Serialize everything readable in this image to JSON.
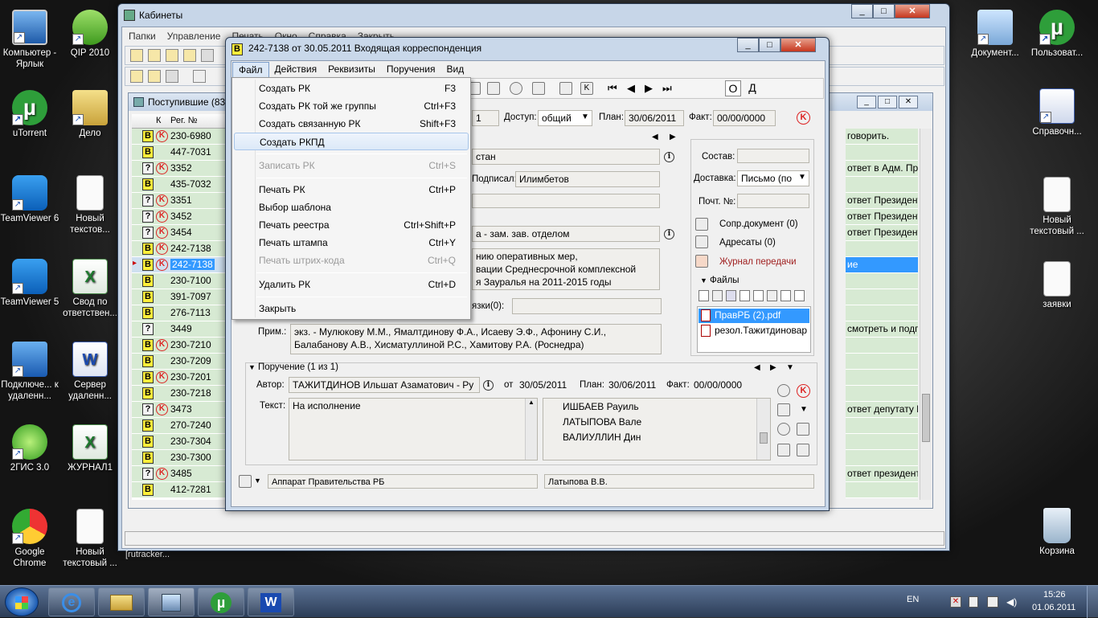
{
  "desktop": {
    "left_icons": [
      "Компьютер - Ярлык",
      "QIP 2010",
      "uTorrent",
      "Дело",
      "TeamViewer 6",
      "Новый текстов...",
      "TeamViewer 5",
      "Свод по ответствен...",
      "Подключе... к удаленн...",
      "Сервер удаленн...",
      "2ГИС 3.0",
      "ЖУРНАЛ1",
      "Google Chrome",
      "Новый текстовый ..."
    ],
    "right_icons": [
      "Документ...",
      "Пользоват...",
      "Справочн...",
      "Новый текстовый ...",
      "заявки",
      "Корзина"
    ],
    "bg_label": "[rutracker..."
  },
  "main_window": {
    "title": "Кабинеты",
    "menu": [
      "Папки",
      "Управление",
      "Печать",
      "Окно",
      "Справка",
      "Закрыть"
    ],
    "inner_title": "Поступившие (83",
    "grid_headers": [
      "К",
      "Рег. №"
    ],
    "rows": [
      {
        "b": "B",
        "k": true,
        "num": "230-6980"
      },
      {
        "b": "B",
        "k": false,
        "num": "447-7031"
      },
      {
        "b": "?",
        "k": true,
        "num": "3352"
      },
      {
        "b": "B",
        "k": false,
        "num": "435-7032"
      },
      {
        "b": "?",
        "k": true,
        "num": "3351"
      },
      {
        "b": "?",
        "k": true,
        "num": "3452"
      },
      {
        "b": "?",
        "k": true,
        "num": "3454"
      },
      {
        "b": "B",
        "k": true,
        "num": "242-7138"
      },
      {
        "b": "B",
        "k": true,
        "num": "242-7138"
      },
      {
        "b": "B",
        "k": false,
        "num": "230-7100"
      },
      {
        "b": "B",
        "k": false,
        "num": "391-7097"
      },
      {
        "b": "B",
        "k": false,
        "num": "276-7113"
      },
      {
        "b": "?",
        "k": false,
        "num": "3449"
      },
      {
        "b": "B",
        "k": true,
        "num": "230-7210"
      },
      {
        "b": "B",
        "k": false,
        "num": "230-7209"
      },
      {
        "b": "B",
        "k": true,
        "num": "230-7201"
      },
      {
        "b": "B",
        "k": false,
        "num": "230-7218"
      },
      {
        "b": "?",
        "k": true,
        "num": "3473"
      },
      {
        "b": "B",
        "k": false,
        "num": "270-7240"
      },
      {
        "b": "B",
        "k": false,
        "num": "230-7304"
      },
      {
        "b": "B",
        "k": false,
        "num": "230-7300"
      },
      {
        "b": "?",
        "k": true,
        "num": "3485"
      },
      {
        "b": "B",
        "k": false,
        "num": "412-7281"
      }
    ],
    "right_texts": [
      "говорить.",
      "",
      "ответ в Адм. Прези",
      "",
      "ответ Президенту Р",
      "ответ Президенту Р",
      "ответ Президенту Р",
      "",
      "ие",
      "",
      "",
      "",
      "смотреть и подготов",
      "",
      "",
      "",
      "",
      "ответ депутату Гос",
      "",
      "",
      "",
      "ответ президенту Р",
      ""
    ]
  },
  "dialog": {
    "badge": "B",
    "title": "242-7138 от 30.05.2011 Входящая корреспонденция",
    "menu": [
      "Файл",
      "Действия",
      "Реквизиты",
      "Поручения",
      "Вид"
    ],
    "toolbar_letters": [
      "О",
      "Д"
    ],
    "num_tail": "1",
    "access_label": "Доступ:",
    "access_value": "общий",
    "plan_label": "План:",
    "plan_value": "30/06/2011",
    "fact_label": "Факт:",
    "fact_value": "00/00/0000",
    "org_tail": "стан",
    "signed_label": "Подписал:",
    "signed_value": "Илимбетов",
    "author_tail": "а - зам. зав. отделом",
    "content_lines": [
      "нию оперативных мер,",
      "вации Среднесрочной комплексной",
      "я Зауралья на 2011-2015 годы"
    ],
    "links_label": "язки(0):",
    "prim_label": "Прим.:",
    "prim_lines": [
      "экз. - Мулюкову М.М., Ямалтдинову Ф.А., Исаеву Э.Ф., Афонину С.И.,",
      "Балабанову А.В., Хисматуллиной Р.С., Хамитову Р.А. (Роснедра)"
    ],
    "right": {
      "sostav_label": "Состав:",
      "dostavka_label": "Доставка:",
      "dostavka_value": "Письмо (по",
      "poch_label": "Почт. №:",
      "sopr_label": "Сопр.документ (0)",
      "adresaty_label": "Адресаты (0)",
      "jurnal_label": "Журнал передачи",
      "files_label": "Файлы",
      "files": [
        "ПравРБ (2).pdf",
        "резол.Тажитдиновар"
      ]
    },
    "assignment": {
      "header": "Поручение (1 из 1)",
      "author_label": "Автор:",
      "author_value": "ТАЖИТДИНОВ Ильшат Азаматович - Ру",
      "from_label": "от",
      "from_value": "30/05/2011",
      "plan_label": "План:",
      "plan_value": "30/06/2011",
      "fact_label": "Факт:",
      "fact_value": "00/00/0000",
      "text_label": "Текст:",
      "text_value": "На исполнение",
      "executors": [
        "ИШБАЕВ Рауиль",
        "ЛАТЫПОВА Вале",
        "ВАЛИУЛЛИН Дин"
      ]
    },
    "status_left": "Аппарат Правительства РБ",
    "status_right": "Латыпова В.В."
  },
  "file_menu": [
    {
      "label": "Создать РК",
      "shortcut": "F3",
      "disabled": false
    },
    {
      "label": "Создать РК той же группы",
      "shortcut": "Ctrl+F3",
      "disabled": false
    },
    {
      "label": "Создать связанную РК",
      "shortcut": "Shift+F3",
      "disabled": false
    },
    {
      "label": "Создать РКПД",
      "shortcut": "",
      "disabled": false,
      "highlight": true
    },
    {
      "label": "Записать РК",
      "shortcut": "Ctrl+S",
      "disabled": true
    },
    {
      "label": "Печать РК",
      "shortcut": "Ctrl+P",
      "disabled": false
    },
    {
      "label": "Выбор шаблона",
      "shortcut": "",
      "disabled": false
    },
    {
      "label": "Печать реестра",
      "shortcut": "Ctrl+Shift+P",
      "disabled": false
    },
    {
      "label": "Печать штампа",
      "shortcut": "Ctrl+Y",
      "disabled": false
    },
    {
      "label": "Печать штрих-кода",
      "shortcut": "Ctrl+Q",
      "disabled": true
    },
    {
      "label": "Удалить РК",
      "shortcut": "Ctrl+D",
      "disabled": false
    },
    {
      "label": "Закрыть",
      "shortcut": "",
      "disabled": false
    }
  ],
  "taskbar": {
    "lang": "EN",
    "time": "15:26",
    "date": "01.06.2011"
  }
}
